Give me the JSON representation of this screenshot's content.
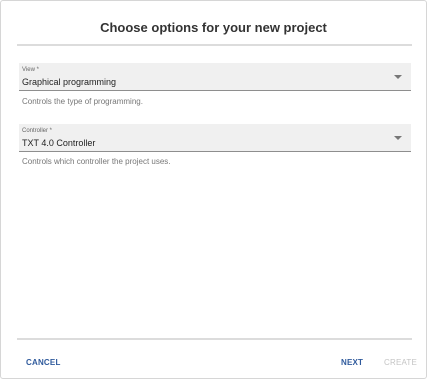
{
  "dialog": {
    "title": "Choose options for your new project"
  },
  "fields": [
    {
      "label": "View *",
      "value": "Graphical programming",
      "helper": "Controls the type of programming."
    },
    {
      "label": "Controller *",
      "value": "TXT 4.0 Controller",
      "helper": "Controls which controller the project uses."
    }
  ],
  "actions": {
    "cancel": "CANCEL",
    "next": "NEXT",
    "create": "CREATE"
  },
  "icons": {
    "dropdown": "chevron-down-icon"
  }
}
